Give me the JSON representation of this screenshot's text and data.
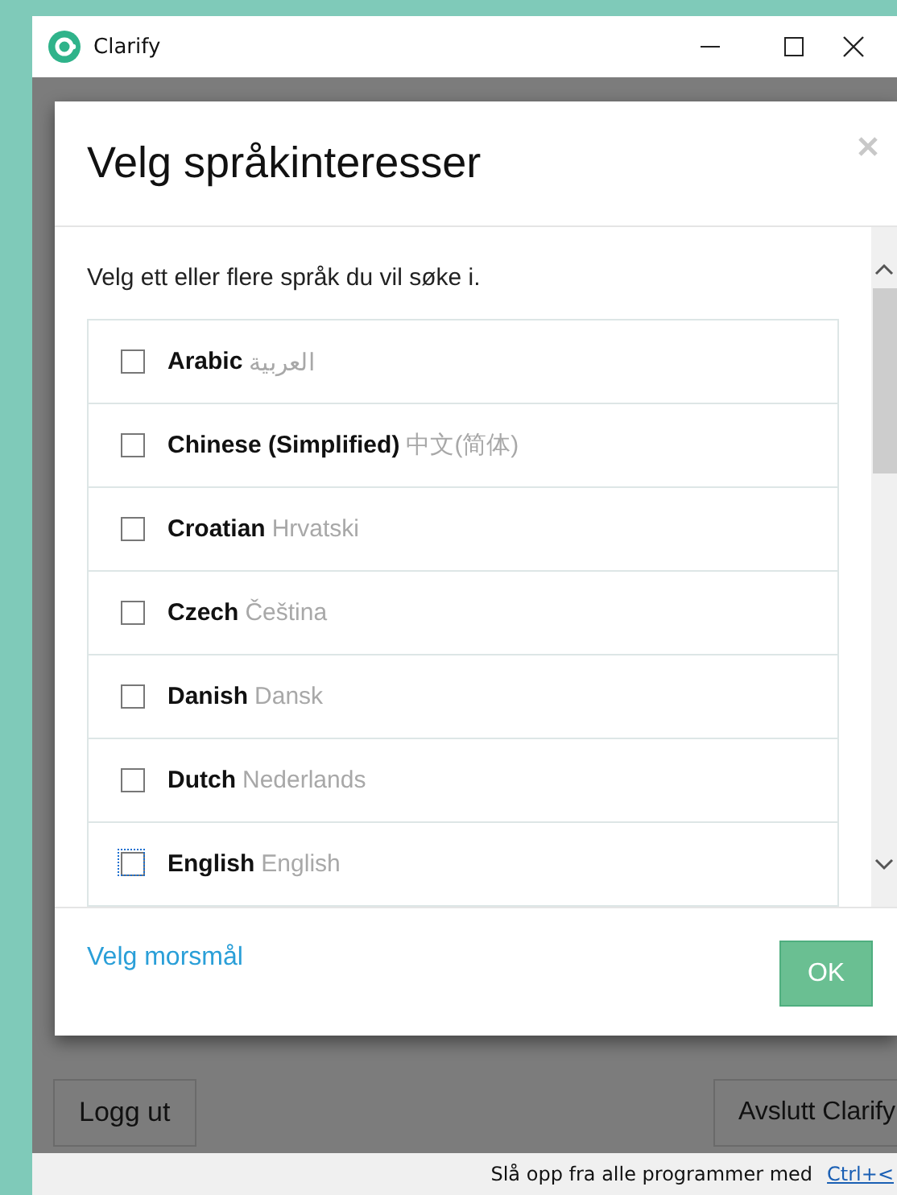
{
  "window": {
    "title": "Clarify"
  },
  "dialog": {
    "title": "Velg språkinteresser",
    "instruction": "Velg ett eller flere språk du vil søke i.",
    "languages": [
      {
        "name": "Arabic",
        "native": "العربية",
        "checked": false,
        "focused": false
      },
      {
        "name": "Chinese (Simplified)",
        "native": "中文(简体)",
        "checked": false,
        "focused": false
      },
      {
        "name": "Croatian",
        "native": "Hrvatski",
        "checked": false,
        "focused": false
      },
      {
        "name": "Czech",
        "native": "Čeština",
        "checked": false,
        "focused": false
      },
      {
        "name": "Danish",
        "native": "Dansk",
        "checked": false,
        "focused": false
      },
      {
        "name": "Dutch",
        "native": "Nederlands",
        "checked": false,
        "focused": false
      },
      {
        "name": "English",
        "native": "English",
        "checked": false,
        "focused": true
      }
    ],
    "link": "Velg morsmål",
    "ok_button": "OK"
  },
  "buttons": {
    "logout": "Logg ut",
    "quit": "Avslutt Clarify"
  },
  "status_bar": {
    "text": "Slå opp fra alle programmer med",
    "shortcut": "Ctrl+<"
  }
}
